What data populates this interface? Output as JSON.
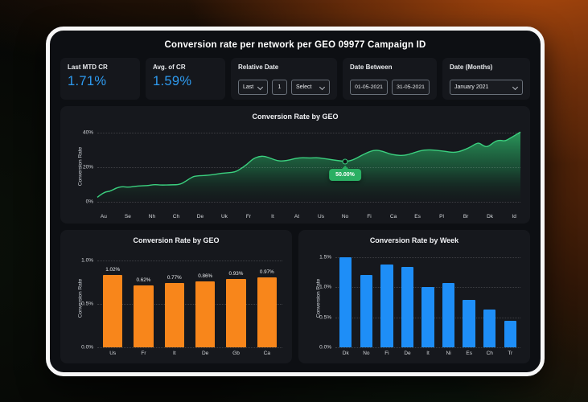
{
  "header": {
    "title": "Conversion rate per network per GEO 09977 Campaign ID"
  },
  "kpis": [
    {
      "label": "Last MTD CR",
      "value": "1.71%"
    },
    {
      "label": "Avg. of CR",
      "value": "1.59%"
    }
  ],
  "filters": {
    "relative_date": {
      "label": "Relative Date",
      "dropdown1": "Last",
      "input_value": "1",
      "dropdown2": "Select"
    },
    "date_between": {
      "label": "Date Between",
      "start": "01-05-2021",
      "end": "31-05-2021"
    },
    "date_months": {
      "label": "Date (Months)",
      "value": "January 2021"
    }
  },
  "colors": {
    "kpi_value": "#2e9bf0",
    "area_line": "#3bd07f",
    "area_fill_top": "#2b9e5e",
    "tooltip_bg": "#2aaf63",
    "orange_bar": "#F8861B",
    "blue_bar": "#1E8EF7",
    "frame_border": "#f7f7f7",
    "panel_bg": "#16181d"
  },
  "chart_data": [
    {
      "type": "area",
      "title": "Conversion Rate by GEO",
      "ylabel": "Conversion Rate",
      "categories": [
        "Au",
        "Se",
        "Nh",
        "Ch",
        "De",
        "Uk",
        "Fr",
        "It",
        "At",
        "Us",
        "No",
        "Fi",
        "Ca",
        "Es",
        "Pl",
        "Br",
        "Dk",
        "Id"
      ],
      "values": [
        3,
        9,
        9.5,
        10,
        15,
        16.5,
        21,
        24,
        25,
        25,
        23.5,
        29.5,
        27,
        30,
        29,
        32,
        35.5,
        40.5
      ],
      "yticks": [
        {
          "v": 0,
          "label": "0%"
        },
        {
          "v": 20,
          "label": "20%"
        },
        {
          "v": 40,
          "label": "40%"
        }
      ],
      "ylim": [
        0,
        42
      ],
      "grid": "dotted",
      "tooltip": {
        "text": "50.00%",
        "category": "No",
        "x_index": 10,
        "v": 23.3
      },
      "path_points": [
        [
          0,
          2.5
        ],
        [
          1.5,
          5.5
        ],
        [
          3,
          6
        ],
        [
          4.5,
          8
        ],
        [
          5.9,
          8.8
        ],
        [
          7.5,
          8.3
        ],
        [
          9.5,
          9.2
        ],
        [
          11.8,
          9.3
        ],
        [
          13.5,
          10
        ],
        [
          15,
          9.6
        ],
        [
          17.6,
          9.8
        ],
        [
          19.5,
          9.9
        ],
        [
          21,
          12
        ],
        [
          22.5,
          14.5
        ],
        [
          23.5,
          15
        ],
        [
          26,
          15.3
        ],
        [
          27.5,
          15.8
        ],
        [
          29.4,
          16.5
        ],
        [
          31,
          16.8
        ],
        [
          32.5,
          17.2
        ],
        [
          33.5,
          18.5
        ],
        [
          35.3,
          21.5
        ],
        [
          36.8,
          25
        ],
        [
          38.2,
          26.3
        ],
        [
          39.5,
          26.5
        ],
        [
          41.2,
          25
        ],
        [
          42.5,
          23.8
        ],
        [
          44,
          23.6
        ],
        [
          45.5,
          24.3
        ],
        [
          47,
          25.3
        ],
        [
          48.5,
          25.6
        ],
        [
          50,
          25.4
        ],
        [
          52,
          25.6
        ],
        [
          52.9,
          25.3
        ],
        [
          54.5,
          24.7
        ],
        [
          56.5,
          24
        ],
        [
          58.8,
          23.3
        ],
        [
          60.5,
          24.3
        ],
        [
          62.5,
          27
        ],
        [
          64.7,
          29.5
        ],
        [
          66,
          30
        ],
        [
          67.5,
          29.3
        ],
        [
          69,
          27.8
        ],
        [
          70.6,
          27
        ],
        [
          72.5,
          26.8
        ],
        [
          74,
          27.8
        ],
        [
          76.5,
          29.8
        ],
        [
          78,
          30.2
        ],
        [
          79.5,
          30
        ],
        [
          81,
          29.6
        ],
        [
          82.4,
          29.2
        ],
        [
          84,
          28.6
        ],
        [
          85.5,
          29
        ],
        [
          87,
          30.5
        ],
        [
          88.2,
          31.8
        ],
        [
          89.5,
          33.8
        ],
        [
          90.3,
          34.2
        ],
        [
          91.3,
          32.3
        ],
        [
          92.3,
          31.8
        ],
        [
          94.1,
          35.3
        ],
        [
          95.3,
          35.8
        ],
        [
          96.3,
          35.2
        ],
        [
          97.5,
          36.8
        ],
        [
          100,
          40.5
        ]
      ],
      "y_zero_pct": 93,
      "y_scale_pct": 2.075
    },
    {
      "type": "bar",
      "title": "Conversion Rate by GEO",
      "ylabel": "Conversion Rate",
      "categories": [
        "Us",
        "Fr",
        "It",
        "De",
        "Gb",
        "Ca"
      ],
      "values": [
        1.02,
        0.62,
        0.77,
        0.86,
        0.93,
        0.97
      ],
      "labels": [
        "1.02%",
        "0.62%",
        "0.77%",
        "0.86%",
        "0.93%",
        "0.97%"
      ],
      "yticks": [
        {
          "v": 0,
          "label": "0.0%"
        },
        {
          "v": 0.5,
          "label": "0.5%"
        },
        {
          "v": 1.0,
          "label": "1.0%"
        }
      ],
      "ylim": [
        0,
        1.14
      ],
      "grid": "dotted",
      "bar_color": "#F8861B",
      "bar_fractions": [
        0.73,
        0.63,
        0.65,
        0.67,
        0.69,
        0.71
      ],
      "bar_width_pct": 64
    },
    {
      "type": "bar",
      "title": "Conversion Rate by Week",
      "ylabel": "Conversion Rate",
      "categories": [
        "Dk",
        "No",
        "Fi",
        "De",
        "It",
        "Ni",
        "Es",
        "Ch",
        "Tr"
      ],
      "values": [
        1.5,
        1.21,
        1.38,
        1.34,
        1.0,
        1.08,
        0.79,
        0.63,
        0.44
      ],
      "yticks": [
        {
          "v": 0,
          "label": "0.0%"
        },
        {
          "v": 0.5,
          "label": "0.5%"
        },
        {
          "v": 1.0,
          "label": "1.0%"
        },
        {
          "v": 1.5,
          "label": "1.5%"
        }
      ],
      "ylim": [
        0,
        1.65
      ],
      "grid": "dotted",
      "bar_color": "#1E8EF7",
      "bar_width_pct": 60
    }
  ]
}
